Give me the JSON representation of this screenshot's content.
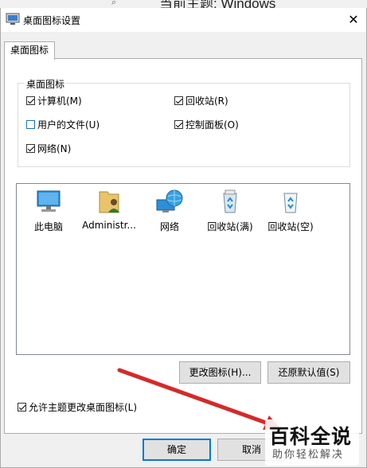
{
  "background_window": {
    "title": "当前主题: Windows"
  },
  "dialog": {
    "title": "桌面图标设置",
    "close_glyph": "✕",
    "tab_label": "桌面图标",
    "group_title": "桌面图标",
    "checkboxes": [
      {
        "label": "计算机(M)",
        "checked": true
      },
      {
        "label": "回收站(R)",
        "checked": true
      },
      {
        "label": "用户的文件(U)",
        "checked": false
      },
      {
        "label": "控制面板(O)",
        "checked": true
      },
      {
        "label": "网络(N)",
        "checked": true
      }
    ],
    "icons": [
      {
        "label": "此电脑",
        "icon": "computer-icon"
      },
      {
        "label": "Administr...",
        "icon": "user-folder-icon"
      },
      {
        "label": "网络",
        "icon": "network-icon"
      },
      {
        "label": "回收站(满)",
        "icon": "recycle-bin-full-icon"
      },
      {
        "label": "回收站(空)",
        "icon": "recycle-bin-empty-icon"
      }
    ],
    "change_icon_label": "更改图标(H)...",
    "restore_default_label": "还原默认值(S)",
    "allow_themes": {
      "label": "允许主题更改桌面图标(L)",
      "checked": true
    },
    "ok_label": "确定",
    "cancel_label": "取消"
  },
  "watermark": {
    "main": "百科全说",
    "sub": "助你轻松解决"
  },
  "colors": {
    "accent": "#0078d7",
    "arrow": "#d42a2a"
  }
}
